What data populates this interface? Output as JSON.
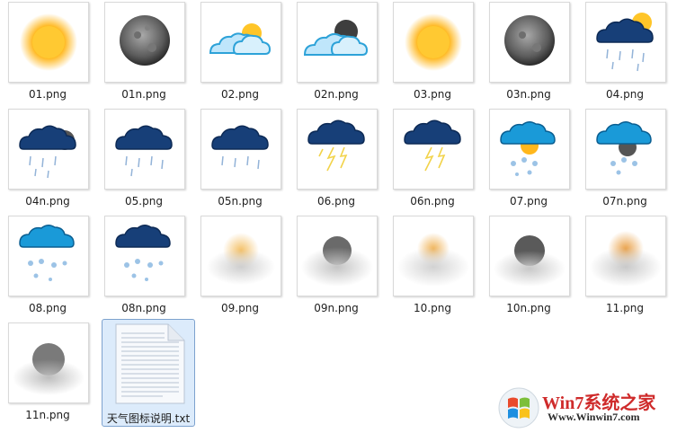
{
  "files": [
    {
      "name": "01.png",
      "icon": "sun-icon"
    },
    {
      "name": "01n.png",
      "icon": "moon-icon"
    },
    {
      "name": "02.png",
      "icon": "sun-behind-clouds-icon"
    },
    {
      "name": "02n.png",
      "icon": "moon-behind-clouds-icon"
    },
    {
      "name": "03.png",
      "icon": "sun-icon"
    },
    {
      "name": "03n.png",
      "icon": "moon-icon"
    },
    {
      "name": "04.png",
      "icon": "sun-dark-cloud-rain-icon"
    },
    {
      "name": "04n.png",
      "icon": "moon-dark-cloud-rain-icon"
    },
    {
      "name": "05.png",
      "icon": "dark-cloud-rain-icon"
    },
    {
      "name": "05n.png",
      "icon": "dark-cloud-rain-icon"
    },
    {
      "name": "06.png",
      "icon": "thunderstorm-icon"
    },
    {
      "name": "06n.png",
      "icon": "thunderstorm-icon"
    },
    {
      "name": "07.png",
      "icon": "sun-cloud-snow-icon"
    },
    {
      "name": "07n.png",
      "icon": "moon-cloud-snow-icon"
    },
    {
      "name": "08.png",
      "icon": "cloud-snow-icon"
    },
    {
      "name": "08n.png",
      "icon": "dark-cloud-snow-icon"
    },
    {
      "name": "09.png",
      "icon": "sun-fog-icon"
    },
    {
      "name": "09n.png",
      "icon": "moon-fog-icon"
    },
    {
      "name": "10.png",
      "icon": "sun-fog-icon"
    },
    {
      "name": "10n.png",
      "icon": "moon-fog-icon"
    },
    {
      "name": "11.png",
      "icon": "sun-fog-icon"
    },
    {
      "name": "11n.png",
      "icon": "moon-fog-icon"
    },
    {
      "name": "天气图标说明.txt",
      "icon": "text-file-icon"
    }
  ],
  "watermark": {
    "brand": "Win7系统之家",
    "url": "Www.Winwin7.com"
  }
}
